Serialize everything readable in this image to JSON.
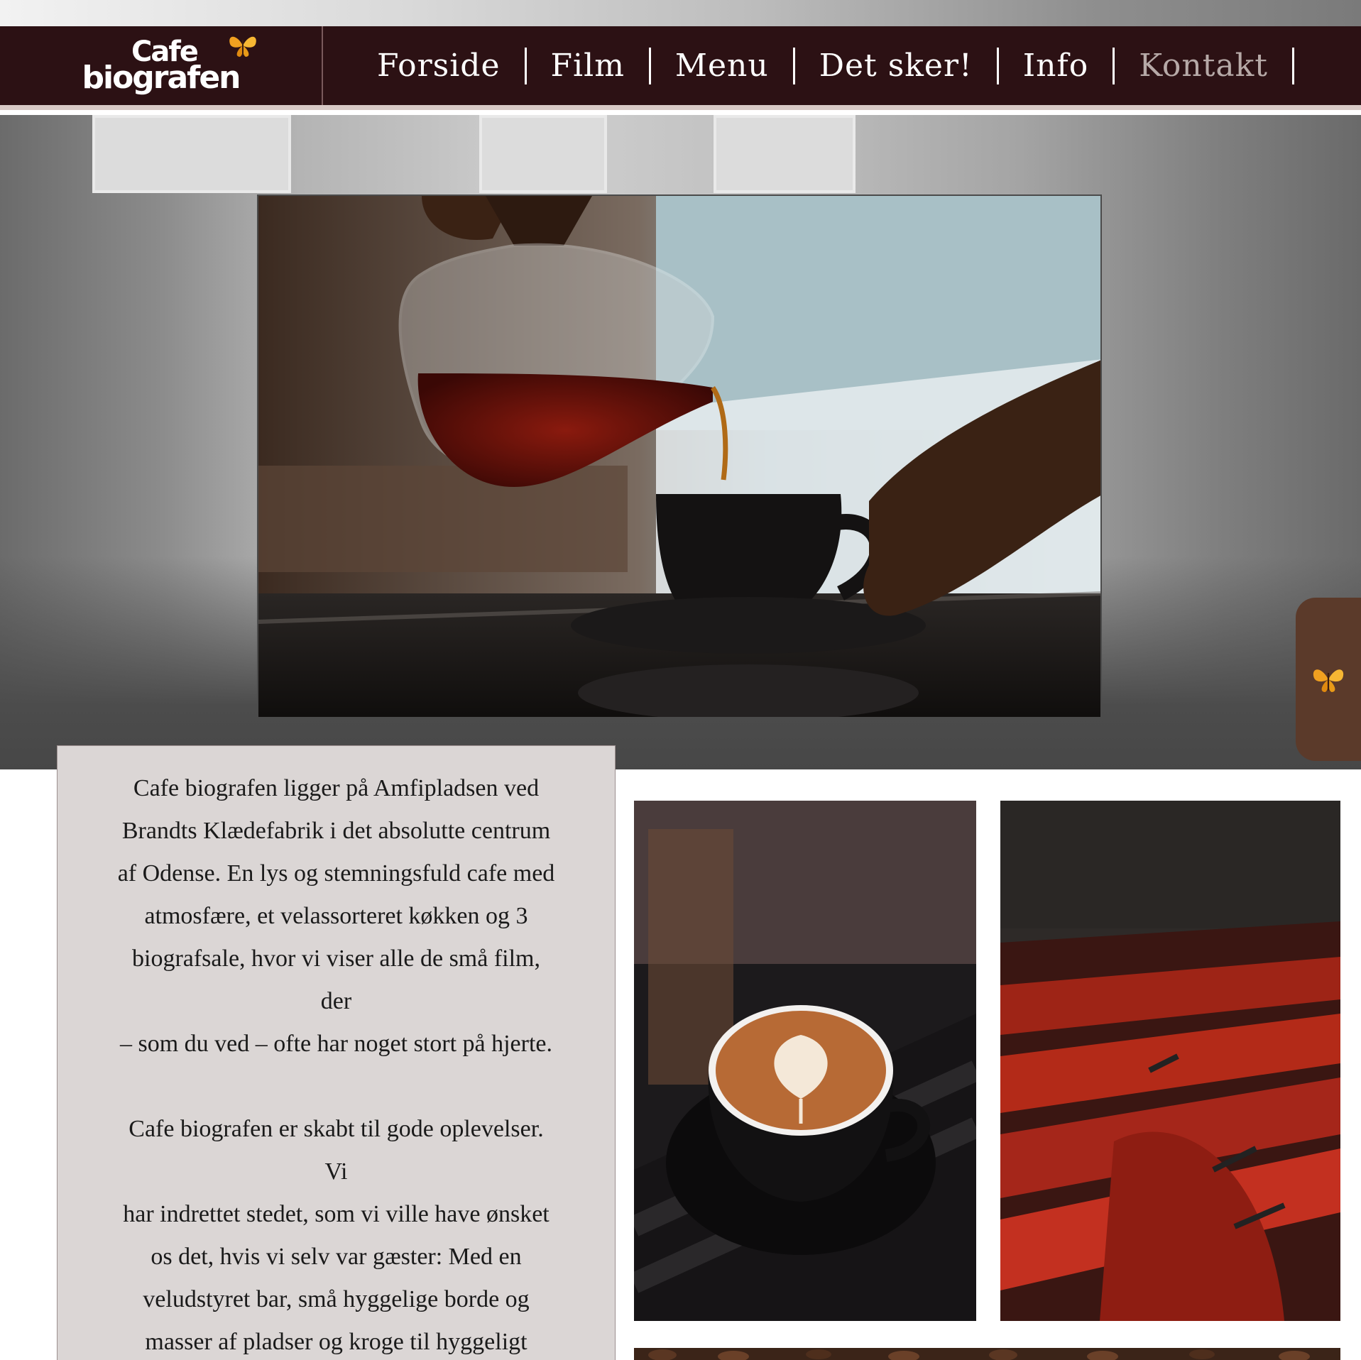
{
  "header": {
    "logo": {
      "line1": "Cafe",
      "line2": "biografen"
    },
    "nav": [
      {
        "label": "Forside"
      },
      {
        "label": "Film"
      },
      {
        "label": "Menu"
      },
      {
        "label": "Det sker!"
      },
      {
        "label": "Info"
      },
      {
        "label": "Kontakt"
      }
    ]
  },
  "colors": {
    "header_bg": "#2c1114",
    "card_bg": "#dbd6d5",
    "side_tab": "#5b3a2a",
    "butterfly": "#f0a020"
  },
  "icons": {
    "logo_mark": "butterfly-icon",
    "side_tab": "butterfly-icon"
  },
  "intro": {
    "paragraph1": "Cafe biografen ligger på Amfipladsen ved\nBrandts Klædefabrik i det absolutte centrum\naf Odense. En lys og stemningsfuld cafe med\natmosfære, et velassorteret køkken og 3\nbiografsale,  hvor vi viser alle de små film,\nder\n– som du ved – ofte har noget stort på hjerte.",
    "paragraph2": "Cafe biografen er skabt til gode oplevelser.\nVi\nhar indrettet stedet, som vi ville have ønsket\nos det, hvis vi selv var gæster: Med en\nveludstyret bar, små hyggelige borde og\nmasser af pladser og kroge til hyggeligt"
  }
}
